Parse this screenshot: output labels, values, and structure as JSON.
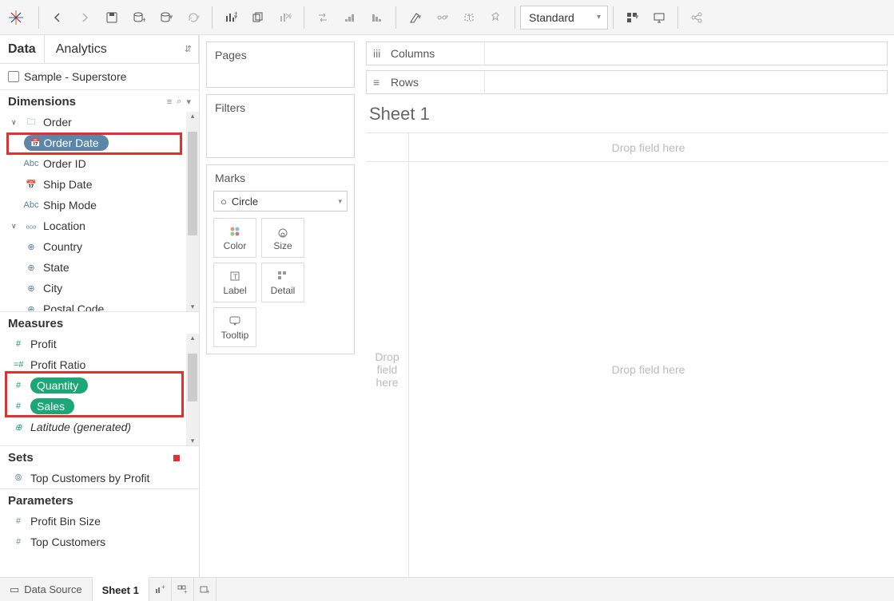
{
  "toolbar": {
    "fit_label": "Standard"
  },
  "dataTab": "Data",
  "analyticsTab": "Analytics",
  "datasource": "Sample - Superstore",
  "sections": {
    "dimensions": "Dimensions",
    "measures": "Measures",
    "sets": "Sets",
    "parameters": "Parameters"
  },
  "dimGroups": {
    "order": "Order",
    "location": "Location"
  },
  "dimFields": {
    "orderDate": "Order Date",
    "orderId": "Order ID",
    "shipDate": "Ship Date",
    "shipMode": "Ship Mode",
    "country": "Country",
    "state": "State",
    "city": "City",
    "postalCode": "Postal Code"
  },
  "measFields": {
    "profit": "Profit",
    "profitRatio": "Profit Ratio",
    "quantity": "Quantity",
    "sales": "Sales",
    "latGen": "Latitude (generated)"
  },
  "setFields": {
    "topCust": "Top Customers by Profit"
  },
  "paramFields": {
    "profitBin": "Profit Bin Size",
    "topCust": "Top Customers"
  },
  "shelves": {
    "pages": "Pages",
    "filters": "Filters",
    "marks": "Marks",
    "columns": "Columns",
    "rows": "Rows"
  },
  "marks": {
    "type": "Circle",
    "color": "Color",
    "size": "Size",
    "label": "Label",
    "detail": "Detail",
    "tooltip": "Tooltip"
  },
  "sheet": {
    "title": "Sheet 1"
  },
  "drop": {
    "top": "Drop field here",
    "left": "Drop field here",
    "main": "Drop field here"
  },
  "bottom": {
    "dataSource": "Data Source",
    "sheet1": "Sheet 1"
  }
}
